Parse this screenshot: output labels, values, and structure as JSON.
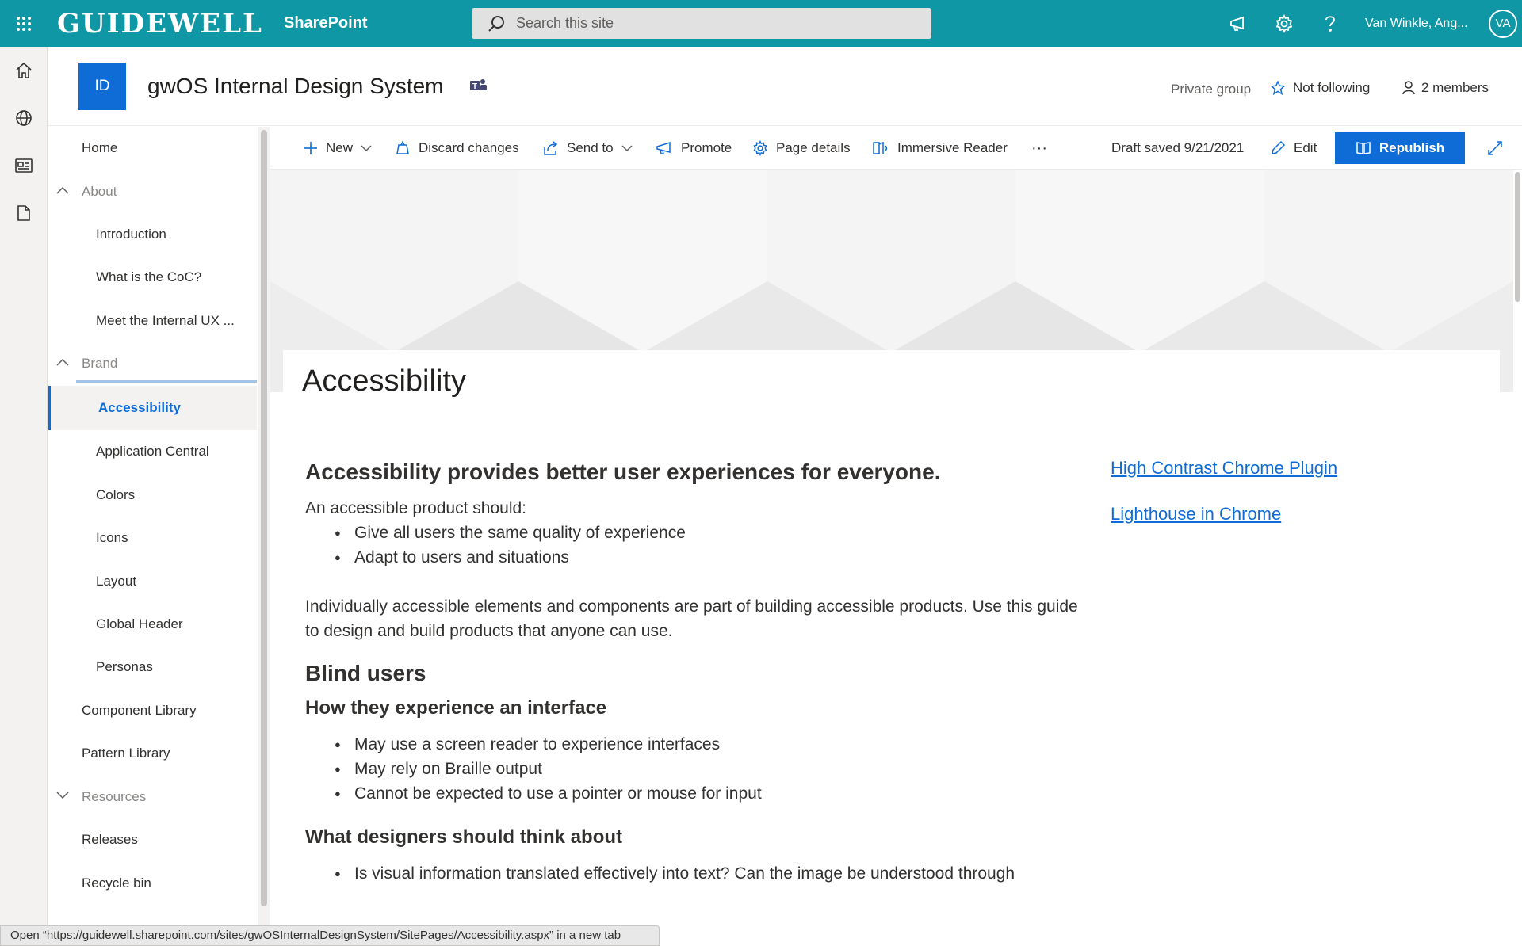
{
  "suitebar": {
    "logo": "GUIDEWELL",
    "app_name": "SharePoint",
    "search_placeholder": "Search this site",
    "user_name": "Van Winkle, Ang...",
    "user_initials": "VA"
  },
  "site": {
    "logo_text": "ID",
    "title": "gwOS Internal Design System",
    "privacy": "Private group",
    "follow_label": "Not following",
    "members_label": "2 members"
  },
  "nav": {
    "items": [
      {
        "label": "Home"
      },
      {
        "label": "About"
      },
      {
        "label": "Introduction"
      },
      {
        "label": "What is the CoC?"
      },
      {
        "label": "Meet the Internal UX ..."
      },
      {
        "label": "Brand"
      },
      {
        "label": "Accessibility"
      },
      {
        "label": "Application Central"
      },
      {
        "label": "Colors"
      },
      {
        "label": "Icons"
      },
      {
        "label": "Layout"
      },
      {
        "label": "Global Header"
      },
      {
        "label": "Personas"
      },
      {
        "label": "Component Library"
      },
      {
        "label": "Pattern Library"
      },
      {
        "label": "Resources"
      },
      {
        "label": "Releases"
      },
      {
        "label": "Recycle bin"
      }
    ]
  },
  "toolbar": {
    "new": "New",
    "discard": "Discard changes",
    "send_to": "Send to",
    "promote": "Promote",
    "page_details": "Page details",
    "immersive_reader": "Immersive Reader",
    "more": "···",
    "draft_status": "Draft saved 9/21/2021",
    "edit": "Edit",
    "republish": "Republish"
  },
  "page": {
    "title": "Accessibility",
    "heading1": "Accessibility provides better user experiences for everyone.",
    "intro": "An accessible product should:",
    "intro_bullets": [
      "Give all users the same quality of experience",
      "Adapt to users and situations"
    ],
    "paragraph": "Individually accessible elements and components are part of building accessible products. Use this guide to design and build products that anyone can use.",
    "heading2": "Blind users",
    "subheading1": "How they experience an interface",
    "experience_bullets": [
      "May use a screen reader to experience interfaces",
      "May rely on Braille output",
      "Cannot be expected to use a pointer or mouse for input"
    ],
    "subheading2": "What designers should think about",
    "designer_bullets": [
      "Is visual information translated effectively into text? Can the image be understood through"
    ],
    "links": [
      "High Contrast Chrome Plugin",
      "Lighthouse in Chrome"
    ]
  },
  "statusbar": {
    "text": "Open “https://guidewell.sharepoint.com/sites/gwOSInternalDesignSystem/SitePages/Accessibility.aspx” in a new tab"
  },
  "colors": {
    "suitebar": "#0f97a5",
    "accent": "#0f6cd6",
    "text": "#323130",
    "muted": "#8a8886"
  },
  "icons": [
    "waffle-icon",
    "search-icon",
    "megaphone-icon",
    "gear-icon",
    "help-icon",
    "home-icon",
    "globe-icon",
    "news-icon",
    "document-icon",
    "teams-icon",
    "star-icon",
    "person-icon",
    "plus-icon",
    "discard-icon",
    "share-icon",
    "promote-icon",
    "settings-icon",
    "immersive-reader-icon",
    "pencil-icon",
    "book-icon",
    "expand-icon"
  ]
}
